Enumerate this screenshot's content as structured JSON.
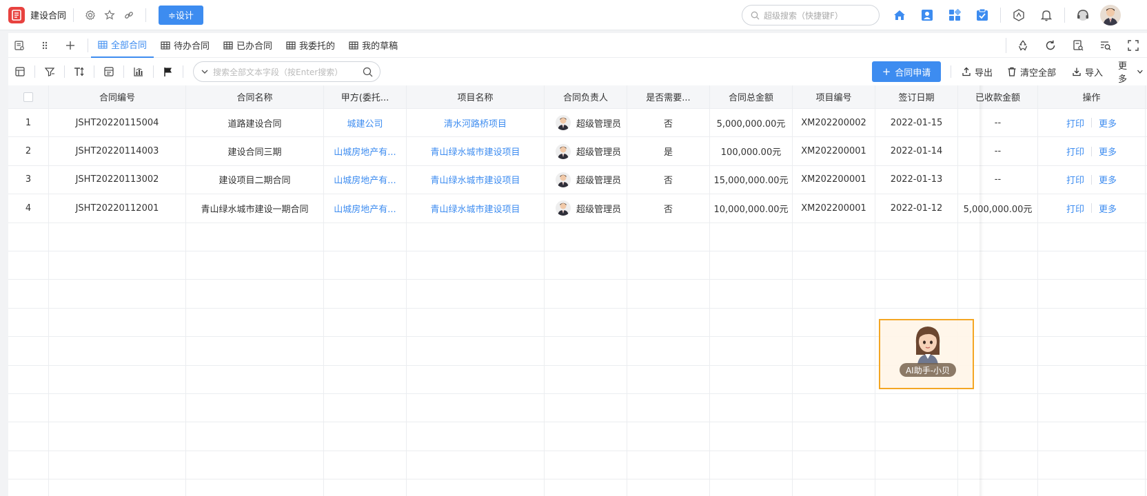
{
  "app": {
    "title": "建设合同",
    "design_label": "≑设计"
  },
  "global_search": {
    "placeholder": "超级搜索（快捷键F）"
  },
  "tabs": [
    {
      "label": "全部合同",
      "active": true
    },
    {
      "label": "待办合同"
    },
    {
      "label": "已办合同"
    },
    {
      "label": "我委托的"
    },
    {
      "label": "我的草稿"
    }
  ],
  "toolbar": {
    "search_placeholder": "搜索全部文本字段（按Enter搜索）",
    "apply_label": "合同申请",
    "export_label": "导出",
    "clear_label": "清空全部",
    "import_label": "导入",
    "more_label": "更多"
  },
  "table": {
    "columns": [
      "合同编号",
      "合同名称",
      "甲方(委托...",
      "项目名称",
      "合同负责人",
      "是否需要...",
      "合同总金额",
      "项目编号",
      "签订日期",
      "已收款金额",
      "操作"
    ],
    "rows": [
      {
        "idx": "1",
        "code": "JSHT20220115004",
        "name": "道路建设合同",
        "party": "城建公司",
        "project": "清水河路桥项目",
        "owner": "超级管理员",
        "need": "否",
        "amount": "5,000,000.00元",
        "proj_code": "XM202200002",
        "date": "2022-01-15",
        "received": "--"
      },
      {
        "idx": "2",
        "code": "JSHT20220114003",
        "name": "建设合同三期",
        "party": "山城房地产有...",
        "project": "青山绿水城市建设项目",
        "owner": "超级管理员",
        "need": "是",
        "amount": "100,000.00元",
        "proj_code": "XM202200001",
        "date": "2022-01-14",
        "received": "--"
      },
      {
        "idx": "3",
        "code": "JSHT20220113002",
        "name": "建设项目二期合同",
        "party": "山城房地产有...",
        "project": "青山绿水城市建设项目",
        "owner": "超级管理员",
        "need": "否",
        "amount": "15,000,000.00元",
        "proj_code": "XM202200001",
        "date": "2022-01-13",
        "received": "--"
      },
      {
        "idx": "4",
        "code": "JSHT20220112001",
        "name": "青山绿水城市建设一期合同",
        "party": "山城房地产有...",
        "project": "青山绿水城市建设项目",
        "owner": "超级管理员",
        "need": "否",
        "amount": "10,000,000.00元",
        "proj_code": "XM202200001",
        "date": "2022-01-12",
        "received": "5,000,000.00元"
      }
    ],
    "row_actions": {
      "print": "打印",
      "more": "更多"
    }
  },
  "assistant": {
    "label": "AI助手-小贝"
  },
  "colors": {
    "primary": "#3d8cf0",
    "logo": "#e8423f",
    "assistant_border": "#f4a623"
  }
}
